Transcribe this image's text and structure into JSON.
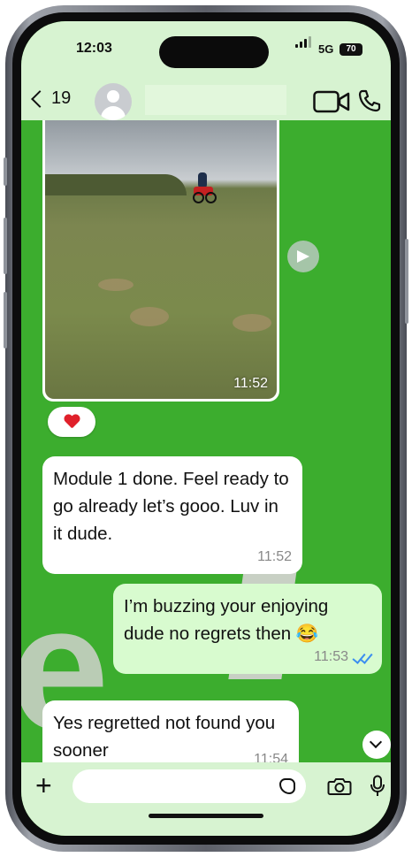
{
  "status_bar": {
    "time": "12:03",
    "network": "5G",
    "battery": "70"
  },
  "header": {
    "back_count": "19",
    "contact_name": ""
  },
  "messages": [
    {
      "type": "image",
      "direction": "incoming",
      "time": "11:52",
      "reaction": "heart"
    },
    {
      "type": "text",
      "direction": "incoming",
      "text": "Module 1 done. Feel ready to go already let’s gooo. Luv in it dude.",
      "time": "11:52"
    },
    {
      "type": "text",
      "direction": "outgoing",
      "text": "I’m buzzing your enjoying dude no regrets then 😂",
      "time": "11:53",
      "status": "read"
    },
    {
      "type": "text",
      "direction": "incoming",
      "text": "Yes regretted not found you sooner",
      "time": "11:54"
    }
  ],
  "watermark": {
    "left": "e",
    "right": "x"
  },
  "input": {
    "placeholder": ""
  },
  "colors": {
    "chat_bg": "#3cad2e",
    "bar_bg": "#d7f3d1",
    "outgoing": "#d8fbcf",
    "incoming": "#ffffff",
    "tick": "#3b8ef0"
  },
  "icons": [
    "back-chevron-icon",
    "video-call-icon",
    "phone-call-icon",
    "forward-icon",
    "heart-icon",
    "read-ticks-icon",
    "scroll-down-icon",
    "plus-icon",
    "sticker-icon",
    "camera-icon",
    "microphone-icon"
  ]
}
